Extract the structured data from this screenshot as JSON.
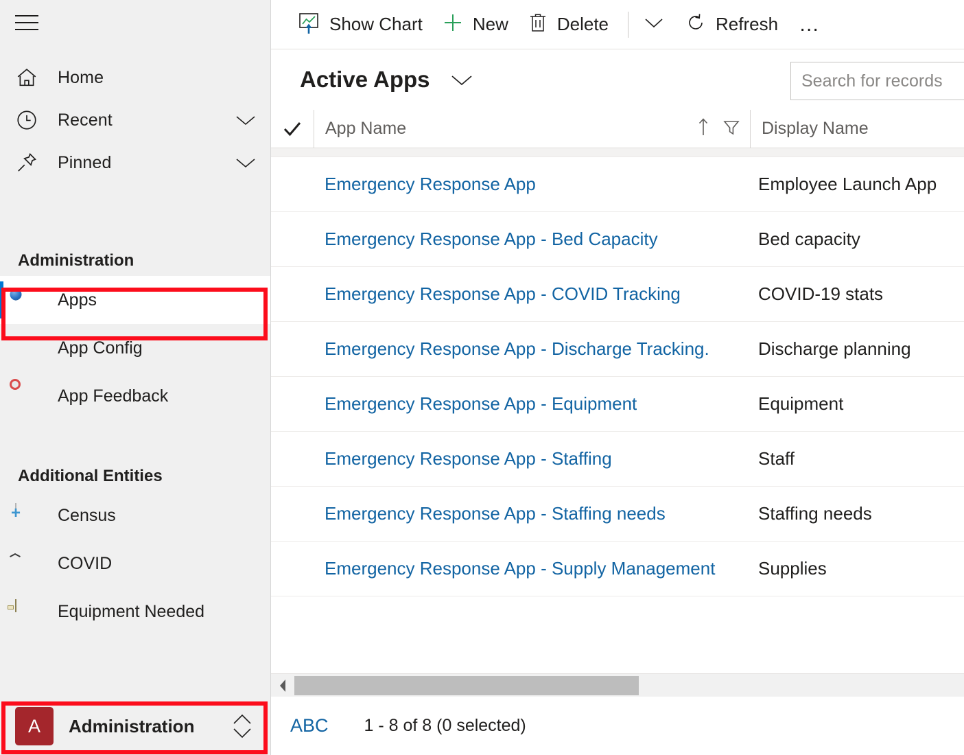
{
  "sidebar": {
    "hamburger_name": "site-map-toggle",
    "nav": [
      {
        "label": "Home",
        "icon": "home-icon",
        "has_chevron": false
      },
      {
        "label": "Recent",
        "icon": "clock-icon",
        "has_chevron": true
      },
      {
        "label": "Pinned",
        "icon": "pin-icon",
        "has_chevron": true
      }
    ],
    "groups": [
      {
        "title": "Administration",
        "items": [
          {
            "label": "Apps",
            "icon": "apps-globe-icon",
            "selected": true
          },
          {
            "label": "App Config",
            "icon": "app-config-icon",
            "selected": false
          },
          {
            "label": "App Feedback",
            "icon": "app-feedback-icon",
            "selected": false
          }
        ]
      },
      {
        "title": "Additional Entities",
        "items": [
          {
            "label": "Census",
            "icon": "census-icon",
            "selected": false
          },
          {
            "label": "COVID",
            "icon": "covid-bug-icon",
            "selected": false
          },
          {
            "label": "Equipment Needed",
            "icon": "equipment-box-icon",
            "selected": false
          }
        ]
      }
    ],
    "app_switcher": {
      "badge": "A",
      "label": "Administration",
      "badge_color": "#a4262c",
      "icon": "up-down-chevron-icon"
    }
  },
  "command_bar": {
    "items": [
      {
        "label": "Show Chart",
        "icon": "show-chart-icon"
      },
      {
        "label": "New",
        "icon": "plus-icon"
      },
      {
        "label": "Delete",
        "icon": "trash-icon"
      }
    ],
    "overflow_chevron": "chevron-down-icon",
    "refresh": {
      "label": "Refresh",
      "icon": "refresh-icon"
    },
    "more": "…"
  },
  "view": {
    "title": "Active Apps",
    "chevron": "chevron-down-icon"
  },
  "search": {
    "placeholder": "Search for records",
    "value": ""
  },
  "grid": {
    "select_all_icon": "checkmark-icon",
    "columns": [
      {
        "key": "app_name",
        "label": "App Name",
        "sort_icon": "sort-ascending-icon",
        "filter_icon": "filter-icon"
      },
      {
        "key": "display_name",
        "label": "Display Name"
      }
    ],
    "rows": [
      {
        "app_name": "Emergency Response App",
        "display_name": "Employee Launch App"
      },
      {
        "app_name": "Emergency Response App - Bed Capacity",
        "display_name": "Bed capacity"
      },
      {
        "app_name": "Emergency Response App - COVID Tracking",
        "display_name": "COVID-19 stats"
      },
      {
        "app_name": "Emergency Response App - Discharge Tracking.",
        "display_name": "Discharge planning"
      },
      {
        "app_name": "Emergency Response App - Equipment",
        "display_name": "Equipment"
      },
      {
        "app_name": "Emergency Response App - Staffing",
        "display_name": "Staff"
      },
      {
        "app_name": "Emergency Response App - Staffing needs",
        "display_name": "Staffing needs"
      },
      {
        "app_name": "Emergency Response App - Supply Management",
        "display_name": "Supplies"
      }
    ]
  },
  "scrollbar": {
    "left_arrow_icon": "scroll-left-arrow-icon"
  },
  "status": {
    "alpha_index": "ABC",
    "record_count": "1 - 8 of 8 (0 selected)"
  },
  "colors": {
    "link": "#1264a3",
    "accent": "#0078d4",
    "annotation": "#fc0d1c",
    "sidebar_bg": "#f0f0f0"
  }
}
